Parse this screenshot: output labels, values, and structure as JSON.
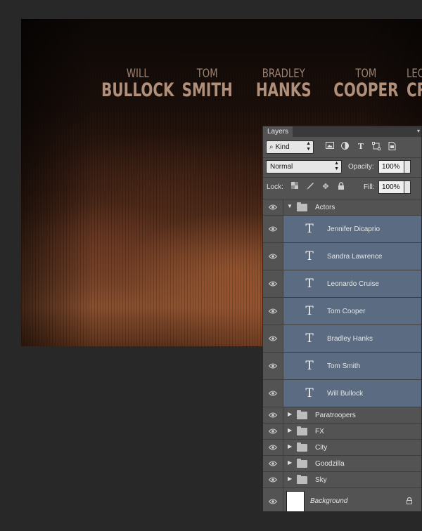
{
  "credits": [
    {
      "first": "WILL",
      "last": "BULLOCK"
    },
    {
      "first": "TOM",
      "last": "SMITH"
    },
    {
      "first": "BRADLEY",
      "last": "HANKS"
    },
    {
      "first": "TOM",
      "last": "COOPER"
    },
    {
      "first": "LEO",
      "last": "CRU"
    }
  ],
  "panel": {
    "tab": "Layers",
    "filter": {
      "kind_label": "Kind",
      "icons": [
        "image-filter-icon",
        "adjustment-filter-icon",
        "type-filter-icon",
        "shape-filter-icon",
        "smart-object-filter-icon"
      ]
    },
    "blend_mode": "Normal",
    "opacity_label": "Opacity:",
    "opacity_value": "100%",
    "lock_label": "Lock:",
    "fill_label": "Fill:",
    "fill_value": "100%"
  },
  "layers": {
    "actors_group": "Actors",
    "text_layers": [
      "Jennifer Dicaprio",
      "Sandra Lawrence",
      "Leonardo Cruise",
      "Tom Cooper",
      "Bradley Hanks",
      "Tom Smith",
      "Will Bullock"
    ],
    "groups": [
      "Paratroopers",
      "FX",
      "City",
      "Goodzilla",
      "Sky"
    ],
    "background": "Background"
  },
  "colors": {
    "selected_layer": "#5a6b82",
    "panel_bg": "#535353",
    "workspace_bg": "#282828"
  }
}
